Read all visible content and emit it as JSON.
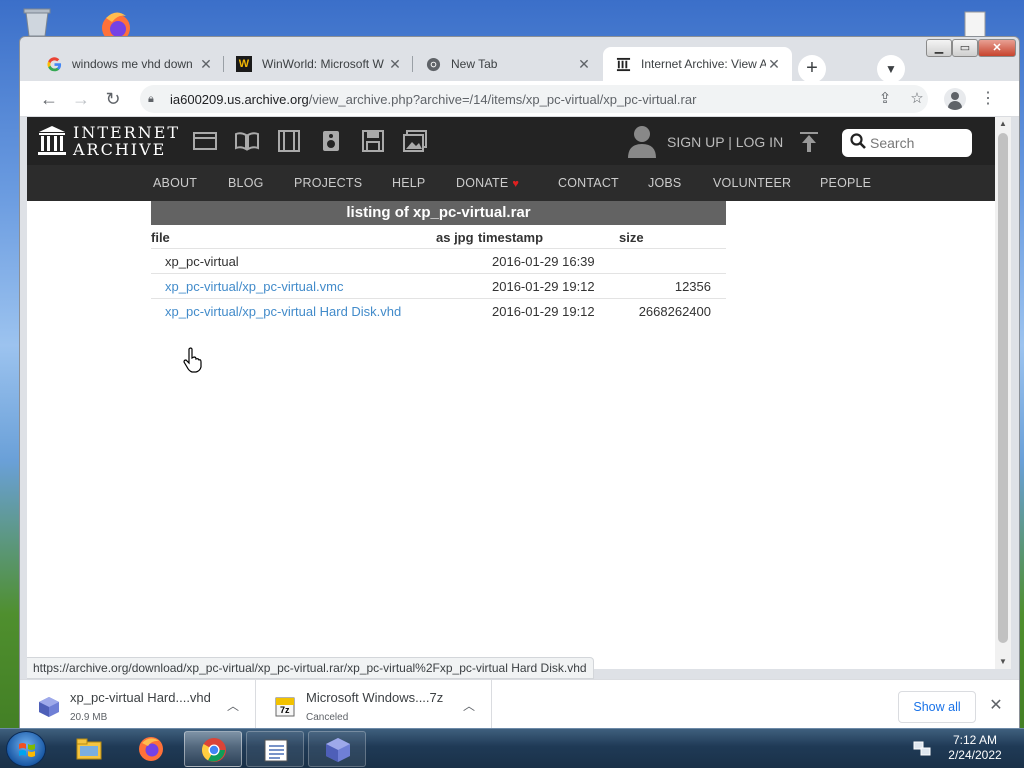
{
  "browser": {
    "tabs": [
      {
        "title": "windows me vhd down",
        "favicon": "google-icon",
        "active": false
      },
      {
        "title": "WinWorld: Microsoft W",
        "favicon": "winworld-icon",
        "active": false
      },
      {
        "title": "New Tab",
        "favicon": "chrome-icon",
        "active": false
      },
      {
        "title": "Internet Archive: View A",
        "favicon": "archive-icon",
        "active": true
      }
    ],
    "new_tab_label": "+",
    "url_host": "ia600209.us.archive.org",
    "url_path": "/view_archive.php?archive=/14/items/xp_pc-virtual/xp_pc-virtual.rar",
    "status_url": "https://archive.org/download/xp_pc-virtual/xp_pc-virtual.rar/xp_pc-virtual%2Fxp_pc-virtual Hard Disk.vhd"
  },
  "ia": {
    "logo_line1": "INTERNET",
    "logo_line2": "ARCHIVE",
    "auth_text": "SIGN UP | LOG IN",
    "search_placeholder": "Search",
    "nav": [
      "ABOUT",
      "BLOG",
      "PROJECTS",
      "HELP",
      "DONATE",
      "CONTACT",
      "JOBS",
      "VOLUNTEER",
      "PEOPLE"
    ]
  },
  "listing": {
    "title": "listing of xp_pc-virtual.rar",
    "headers": {
      "file": "file",
      "as_jpg": "as jpg",
      "timestamp": "timestamp",
      "size": "size"
    },
    "rows": [
      {
        "file": "xp_pc-virtual",
        "timestamp": "2016-01-29 16:39",
        "size": "",
        "link": false
      },
      {
        "file": "xp_pc-virtual/xp_pc-virtual.vmc",
        "timestamp": "2016-01-29 19:12",
        "size": "12356",
        "link": true
      },
      {
        "file": "xp_pc-virtual/xp_pc-virtual Hard Disk.vhd",
        "timestamp": "2016-01-29 19:12",
        "size": "2668262400",
        "link": true
      }
    ]
  },
  "downloads": {
    "items": [
      {
        "name": "xp_pc-virtual Hard....vhd",
        "status": "20.9 MB",
        "icon": "virtualbox-icon"
      },
      {
        "name": "Microsoft Windows....7z",
        "status": "Canceled",
        "icon": "7zip-icon"
      }
    ],
    "show_all": "Show all"
  },
  "taskbar": {
    "time": "7:12 AM",
    "date": "2/24/2022",
    "apps": [
      "file-explorer-icon",
      "firefox-icon",
      "chrome-icon",
      "notepad-icon",
      "virtualbox-icon"
    ]
  },
  "colors": {
    "link": "#428bca",
    "ia_header": "#232323",
    "ia_nav": "#2c2c2c",
    "listing_title_bg": "#636363",
    "donate_heart": "#e02020"
  }
}
